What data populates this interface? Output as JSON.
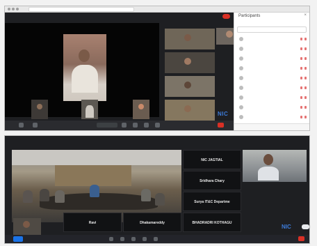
{
  "top_window": {
    "sidebar": {
      "title": "Participants",
      "close_glyph": "×",
      "tabs": [
        "",
        ""
      ],
      "search_placeholder": "",
      "participants": [
        "",
        "",
        "",
        "",
        "",
        "",
        "",
        "",
        "",
        ""
      ]
    },
    "logo_text": "NIC",
    "icons": [
      "search-icon",
      "mic-icon",
      "camera-icon",
      "share-screen-icon",
      "end-call-icon"
    ]
  },
  "bottom_window": {
    "tiles": {
      "nic_jagtial": "NIC JAGTIAL",
      "sridhara_chary": "Sridhara Chary",
      "surya": "Surya IT&C Departme",
      "ravi": "Ravi",
      "dhakamareddy": "Dhakamareddy",
      "bhadradri": "BHADRADRI KOTHAGU"
    },
    "logo_text": "NIC",
    "badge_text": ""
  },
  "colors": {
    "accent": "#1a73e8",
    "end_call": "#d93025",
    "background": "#1e1f22",
    "logo": "#3d7bd9"
  }
}
